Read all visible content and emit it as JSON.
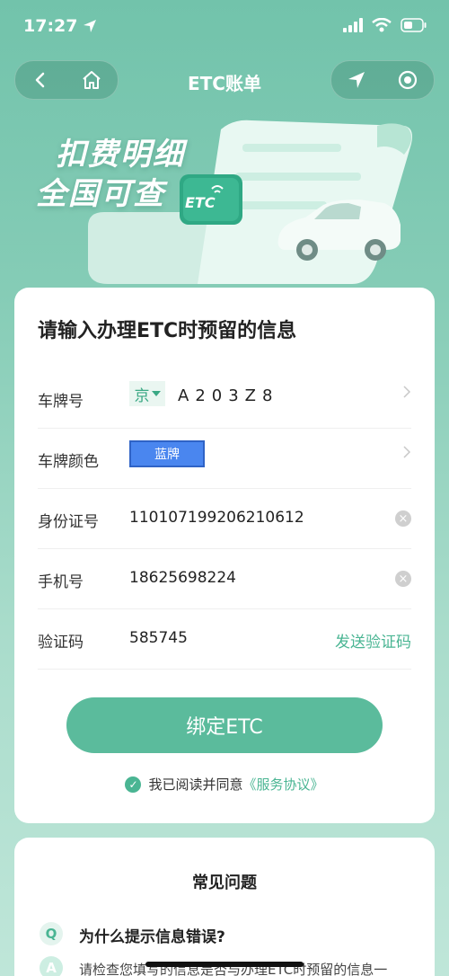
{
  "status_bar": {
    "time": "17:27"
  },
  "nav": {
    "title": "ETC账单"
  },
  "banner": {
    "line1": "扣费明细",
    "line2": "全国可查",
    "etc_logo": "ETC"
  },
  "form": {
    "title": "请输入办理ETC时预留的信息",
    "plate_label": "车牌号",
    "plate_province": "京",
    "plate_number": "A203Z8",
    "color_label": "车牌颜色",
    "color_value": "蓝牌",
    "id_label": "身份证号",
    "id_value": "110107199206210612",
    "phone_label": "手机号",
    "phone_value": "18625698224",
    "code_label": "验证码",
    "code_value": "585745",
    "send_code": "发送验证码",
    "bind_button": "绑定ETC",
    "agree_text": "我已阅读并同意",
    "agreement_link": "《服务协议》"
  },
  "faq": {
    "title": "常见问题",
    "q_badge": "Q",
    "a_badge": "A",
    "question": "为什么提示信息错误?",
    "answer": "请检查您填写的信息是否与办理ETC时预留的信息一"
  },
  "colors": {
    "accent": "#5bbb9c",
    "link": "#4ab593",
    "plate_blue": "#4a86ef"
  },
  "icons": [
    "location-arrow-icon",
    "signal-icon",
    "wifi-icon",
    "battery-icon",
    "back-icon",
    "home-icon",
    "navigate-icon",
    "record-icon",
    "chevron-right-icon",
    "clear-icon",
    "check-icon"
  ]
}
